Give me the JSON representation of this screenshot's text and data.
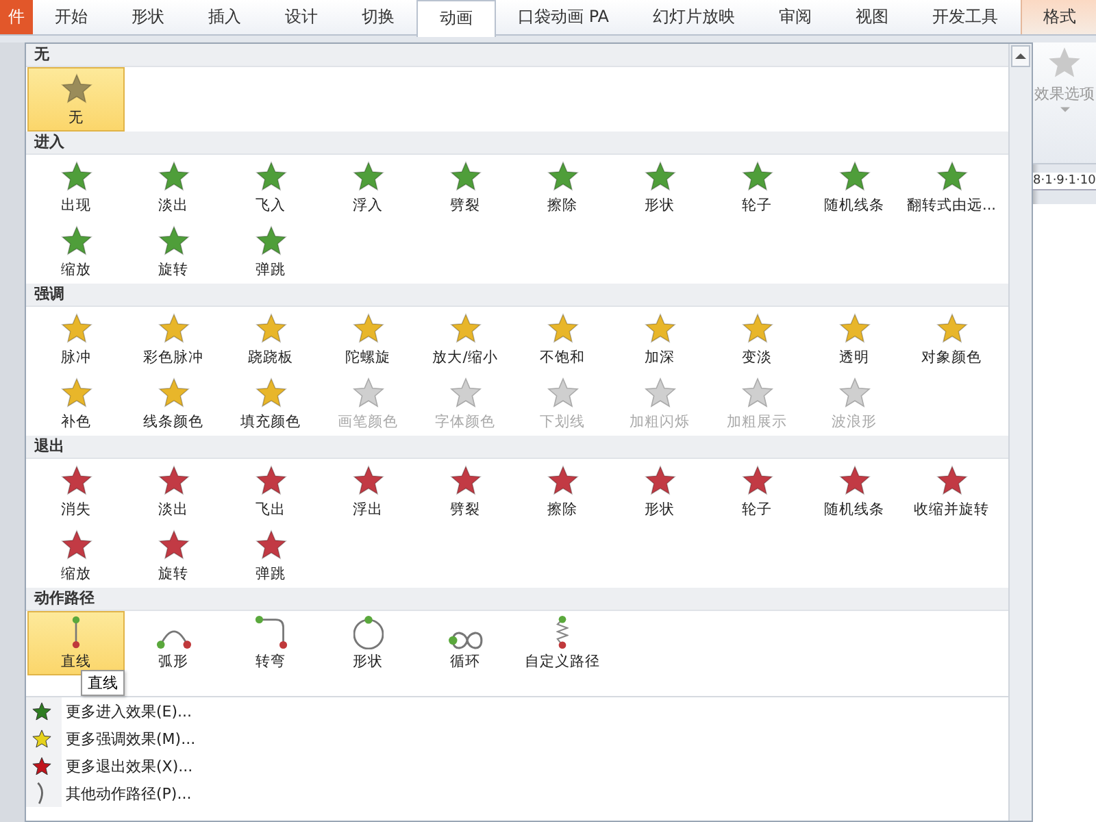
{
  "tabs": [
    {
      "label": "件",
      "kind": "file",
      "selected": false
    },
    {
      "label": "开始",
      "kind": "normal",
      "selected": false
    },
    {
      "label": "形状",
      "kind": "normal",
      "selected": false
    },
    {
      "label": "插入",
      "kind": "normal",
      "selected": false
    },
    {
      "label": "设计",
      "kind": "normal",
      "selected": false
    },
    {
      "label": "切换",
      "kind": "normal",
      "selected": false
    },
    {
      "label": "动画",
      "kind": "normal",
      "selected": true
    },
    {
      "label": "口袋动画 PA",
      "kind": "normal",
      "selected": false
    },
    {
      "label": "幻灯片放映",
      "kind": "normal",
      "selected": false
    },
    {
      "label": "审阅",
      "kind": "normal",
      "selected": false
    },
    {
      "label": "视图",
      "kind": "normal",
      "selected": false
    },
    {
      "label": "开发工具",
      "kind": "normal",
      "selected": false
    },
    {
      "label": "格式",
      "kind": "contextual",
      "selected": false
    }
  ],
  "gallery": {
    "sections": [
      {
        "title": "无",
        "kind": "star",
        "color": "#9a8c5a",
        "items": [
          {
            "label": "无",
            "selected": true,
            "disabled": false
          }
        ]
      },
      {
        "title": "进入",
        "kind": "star",
        "color": "#4f9e3a",
        "items": [
          {
            "label": "出现",
            "selected": false,
            "disabled": false
          },
          {
            "label": "淡出",
            "selected": false,
            "disabled": false
          },
          {
            "label": "飞入",
            "selected": false,
            "disabled": false
          },
          {
            "label": "浮入",
            "selected": false,
            "disabled": false
          },
          {
            "label": "劈裂",
            "selected": false,
            "disabled": false
          },
          {
            "label": "擦除",
            "selected": false,
            "disabled": false
          },
          {
            "label": "形状",
            "selected": false,
            "disabled": false
          },
          {
            "label": "轮子",
            "selected": false,
            "disabled": false
          },
          {
            "label": "随机线条",
            "selected": false,
            "disabled": false
          },
          {
            "label": "翻转式由远...",
            "selected": false,
            "disabled": false
          },
          {
            "label": "缩放",
            "selected": false,
            "disabled": false
          },
          {
            "label": "旋转",
            "selected": false,
            "disabled": false
          },
          {
            "label": "弹跳",
            "selected": false,
            "disabled": false
          }
        ]
      },
      {
        "title": "强调",
        "kind": "star",
        "color": "#e8b62a",
        "items": [
          {
            "label": "脉冲",
            "selected": false,
            "disabled": false
          },
          {
            "label": "彩色脉冲",
            "selected": false,
            "disabled": false
          },
          {
            "label": "跷跷板",
            "selected": false,
            "disabled": false
          },
          {
            "label": "陀螺旋",
            "selected": false,
            "disabled": false
          },
          {
            "label": "放大/缩小",
            "selected": false,
            "disabled": false
          },
          {
            "label": "不饱和",
            "selected": false,
            "disabled": false
          },
          {
            "label": "加深",
            "selected": false,
            "disabled": false
          },
          {
            "label": "变淡",
            "selected": false,
            "disabled": false
          },
          {
            "label": "透明",
            "selected": false,
            "disabled": false
          },
          {
            "label": "对象颜色",
            "selected": false,
            "disabled": false
          },
          {
            "label": "补色",
            "selected": false,
            "disabled": false
          },
          {
            "label": "线条颜色",
            "selected": false,
            "disabled": false
          },
          {
            "label": "填充颜色",
            "selected": false,
            "disabled": false
          },
          {
            "label": "画笔颜色",
            "selected": false,
            "disabled": true
          },
          {
            "label": "字体颜色",
            "selected": false,
            "disabled": true
          },
          {
            "label": "下划线",
            "selected": false,
            "disabled": true
          },
          {
            "label": "加粗闪烁",
            "selected": false,
            "disabled": true
          },
          {
            "label": "加粗展示",
            "selected": false,
            "disabled": true
          },
          {
            "label": "波浪形",
            "selected": false,
            "disabled": true
          }
        ]
      },
      {
        "title": "退出",
        "kind": "star",
        "color": "#c23a44",
        "items": [
          {
            "label": "消失",
            "selected": false,
            "disabled": false
          },
          {
            "label": "淡出",
            "selected": false,
            "disabled": false
          },
          {
            "label": "飞出",
            "selected": false,
            "disabled": false
          },
          {
            "label": "浮出",
            "selected": false,
            "disabled": false
          },
          {
            "label": "劈裂",
            "selected": false,
            "disabled": false
          },
          {
            "label": "擦除",
            "selected": false,
            "disabled": false
          },
          {
            "label": "形状",
            "selected": false,
            "disabled": false
          },
          {
            "label": "轮子",
            "selected": false,
            "disabled": false
          },
          {
            "label": "随机线条",
            "selected": false,
            "disabled": false
          },
          {
            "label": "收缩并旋转",
            "selected": false,
            "disabled": false
          },
          {
            "label": "缩放",
            "selected": false,
            "disabled": false
          },
          {
            "label": "旋转",
            "selected": false,
            "disabled": false
          },
          {
            "label": "弹跳",
            "selected": false,
            "disabled": false
          }
        ]
      },
      {
        "title": "动作路径",
        "kind": "path",
        "items": [
          {
            "label": "直线",
            "kind": "line",
            "selected": true,
            "disabled": false
          },
          {
            "label": "弧形",
            "kind": "arc",
            "selected": false,
            "disabled": false
          },
          {
            "label": "转弯",
            "kind": "turn",
            "selected": false,
            "disabled": false
          },
          {
            "label": "形状",
            "kind": "circle",
            "selected": false,
            "disabled": false
          },
          {
            "label": "循环",
            "kind": "loop",
            "selected": false,
            "disabled": false
          },
          {
            "label": "自定义路径",
            "kind": "custom",
            "selected": false,
            "disabled": false
          }
        ],
        "tooltip": "直线"
      }
    ]
  },
  "menu": [
    {
      "label": "更多进入效果(E)...",
      "kind": "enter"
    },
    {
      "label": "更多强调效果(M)...",
      "kind": "emphasis"
    },
    {
      "label": "更多退出效果(X)...",
      "kind": "exit"
    },
    {
      "label": "其他动作路径(P)...",
      "kind": "path"
    }
  ],
  "effect_options": {
    "label": "效果选项"
  },
  "ruler": {
    "text": "8·1·9·1·10"
  }
}
